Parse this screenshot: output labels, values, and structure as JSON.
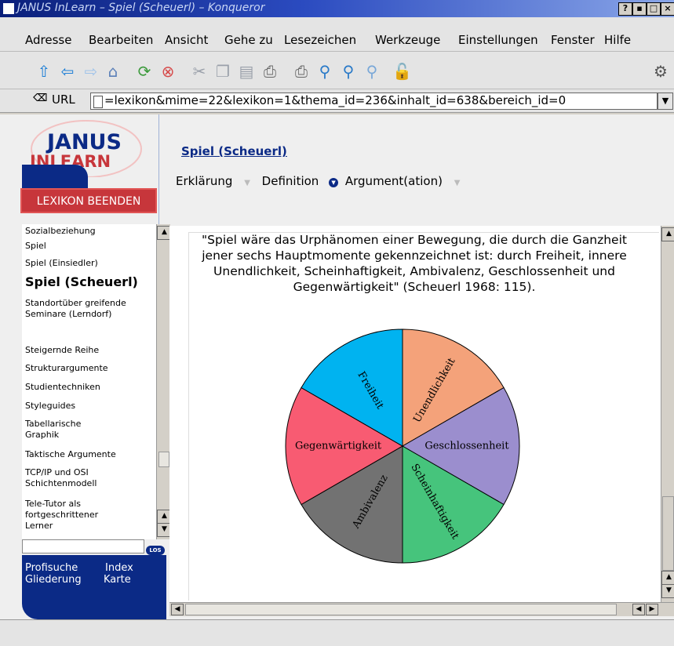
{
  "window": {
    "title": "JANUS InLearn – Spiel (Scheuerl) – Konqueror",
    "buttons": [
      "?",
      "▪",
      "□",
      "×"
    ]
  },
  "menubar": {
    "items": [
      "Adresse",
      "Bearbeiten",
      "Ansicht",
      "Gehe zu",
      "Lesezeichen",
      "Werkzeuge",
      "Einstellungen",
      "Fenster",
      "Hilfe"
    ]
  },
  "toolbar": {
    "icons": [
      "up-icon",
      "back-icon",
      "forward-icon",
      "home-icon",
      "reload-icon",
      "stop-icon",
      "cut-icon",
      "copy-icon",
      "paste-icon",
      "print-icon",
      "print-preview-icon",
      "zoom-fit-icon",
      "zoom-in-icon",
      "zoom-out-icon",
      "security-lock-icon",
      "konqueror-gear-icon"
    ]
  },
  "location": {
    "label": "URL",
    "value": "=lexikon&mime=22&lexikon=1&thema_id=236&inhalt_id=638&bereich_id=0"
  },
  "sidebar": {
    "logo_line1": "JANUS",
    "logo_line2": "INLEARN",
    "end_button": "LEXIKON BEENDEN",
    "items": [
      {
        "label": "Sozialbeziehung",
        "current": false
      },
      {
        "label": "Spiel",
        "current": false
      },
      {
        "label": "Spiel (Einsiedler)",
        "current": false
      },
      {
        "label": "Spiel (Scheuerl)",
        "current": true
      },
      {
        "label": "Standortüber greifende Seminare (Lerndorf)",
        "current": false
      },
      {
        "label": "Steigernde Reihe",
        "current": false
      },
      {
        "label": "Strukturargumente",
        "current": false
      },
      {
        "label": "Studientechniken",
        "current": false
      },
      {
        "label": "Styleguides",
        "current": false
      },
      {
        "label": "Tabellarische Graphik",
        "current": false
      },
      {
        "label": "Taktische Argumente",
        "current": false
      },
      {
        "label": "TCP/IP und OSI Schichtenmodell",
        "current": false
      },
      {
        "label": "Tele-Tutor als fortgeschrittener Lerner",
        "current": false
      }
    ],
    "search_button": "LOS",
    "nav": {
      "profisuche": "Profisuche",
      "index": "Index",
      "gliederung": "Gliederung",
      "karte": "Karte"
    }
  },
  "main": {
    "title": "Spiel (Scheuerl)",
    "tabs": [
      {
        "label": "Erklärung",
        "active": false
      },
      {
        "label": "Definition",
        "active": false
      },
      {
        "label": "Argument(ation)",
        "active": true
      }
    ],
    "quote": "\"Spiel wäre das Urphänomen einer Bewegung, die durch die Ganzheit jener sechs Hauptmomente gekennzeichnet ist: durch Freiheit, innere Unendlichkeit, Scheinhaftigkeit, Ambivalenz, Geschlossenheit und Gegenwärtigkeit\" (Scheuerl 1968: 115)."
  },
  "chart_data": {
    "type": "pie",
    "slices": [
      {
        "label": "Unendlichkeit",
        "value": 1,
        "color": "#f4a27a"
      },
      {
        "label": "Geschlossenheit",
        "value": 1,
        "color": "#9b8ece"
      },
      {
        "label": "Scheinhaftigkeit",
        "value": 1,
        "color": "#46c47c"
      },
      {
        "label": "Ambivalenz",
        "value": 1,
        "color": "#727272"
      },
      {
        "label": "Gegenwärtigkeit",
        "value": 1,
        "color": "#f85b72"
      },
      {
        "label": "Freiheit",
        "value": 1,
        "color": "#00b3f0"
      }
    ]
  },
  "colors": {
    "brand_blue": "#0b2a86",
    "brand_red": "#c7363b"
  }
}
